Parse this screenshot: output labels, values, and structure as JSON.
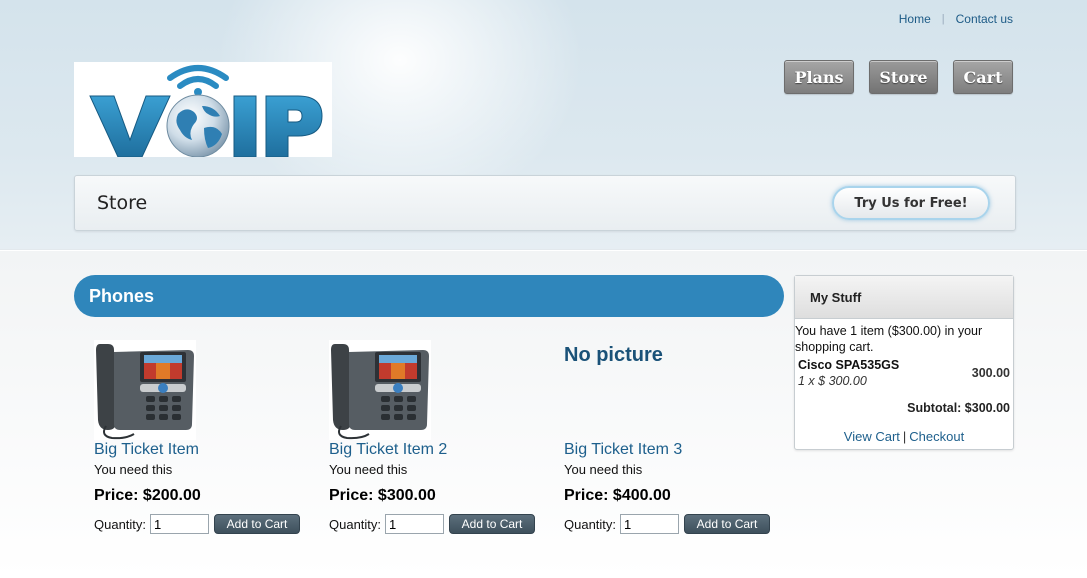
{
  "top_links": {
    "home": "Home",
    "contact": "Contact us"
  },
  "logo": {
    "text": "VOIP"
  },
  "nav": {
    "plans": "Plans",
    "store": "Store",
    "cart": "Cart"
  },
  "page": {
    "title": "Store",
    "cta": "Try Us for Free!"
  },
  "category": {
    "title": "Phones"
  },
  "products": [
    {
      "name": "Big Ticket Item",
      "description": "You need this",
      "price": "Price: $200.00",
      "quantity_label": "Quantity:",
      "quantity": "1",
      "button": "Add to Cart",
      "image": "ip-phone"
    },
    {
      "name": "Big Ticket Item 2",
      "description": "You need this",
      "price": "Price: $300.00",
      "quantity_label": "Quantity:",
      "quantity": "1",
      "button": "Add to Cart",
      "image": "ip-phone"
    },
    {
      "name": "Big Ticket Item 3",
      "description": "You need this",
      "price": "Price: $400.00",
      "quantity_label": "Quantity:",
      "quantity": "1",
      "button": "Add to Cart",
      "image_text": "No picture"
    }
  ],
  "sidebar": {
    "title": "My Stuff",
    "summary": "You have 1 item ($300.00) in your shopping cart.",
    "item_name": "Cisco SPA535GS",
    "item_qty": "1 x $ 300.00",
    "item_total": "300.00",
    "subtotal": "Subtotal: $300.00",
    "view_cart": "View Cart",
    "separator": "|",
    "checkout": "Checkout"
  },
  "colors": {
    "accent": "#2f86bb",
    "link": "#1d5f8c",
    "nav_button": "#8c8c8c",
    "add_button": "#4a5c68"
  }
}
